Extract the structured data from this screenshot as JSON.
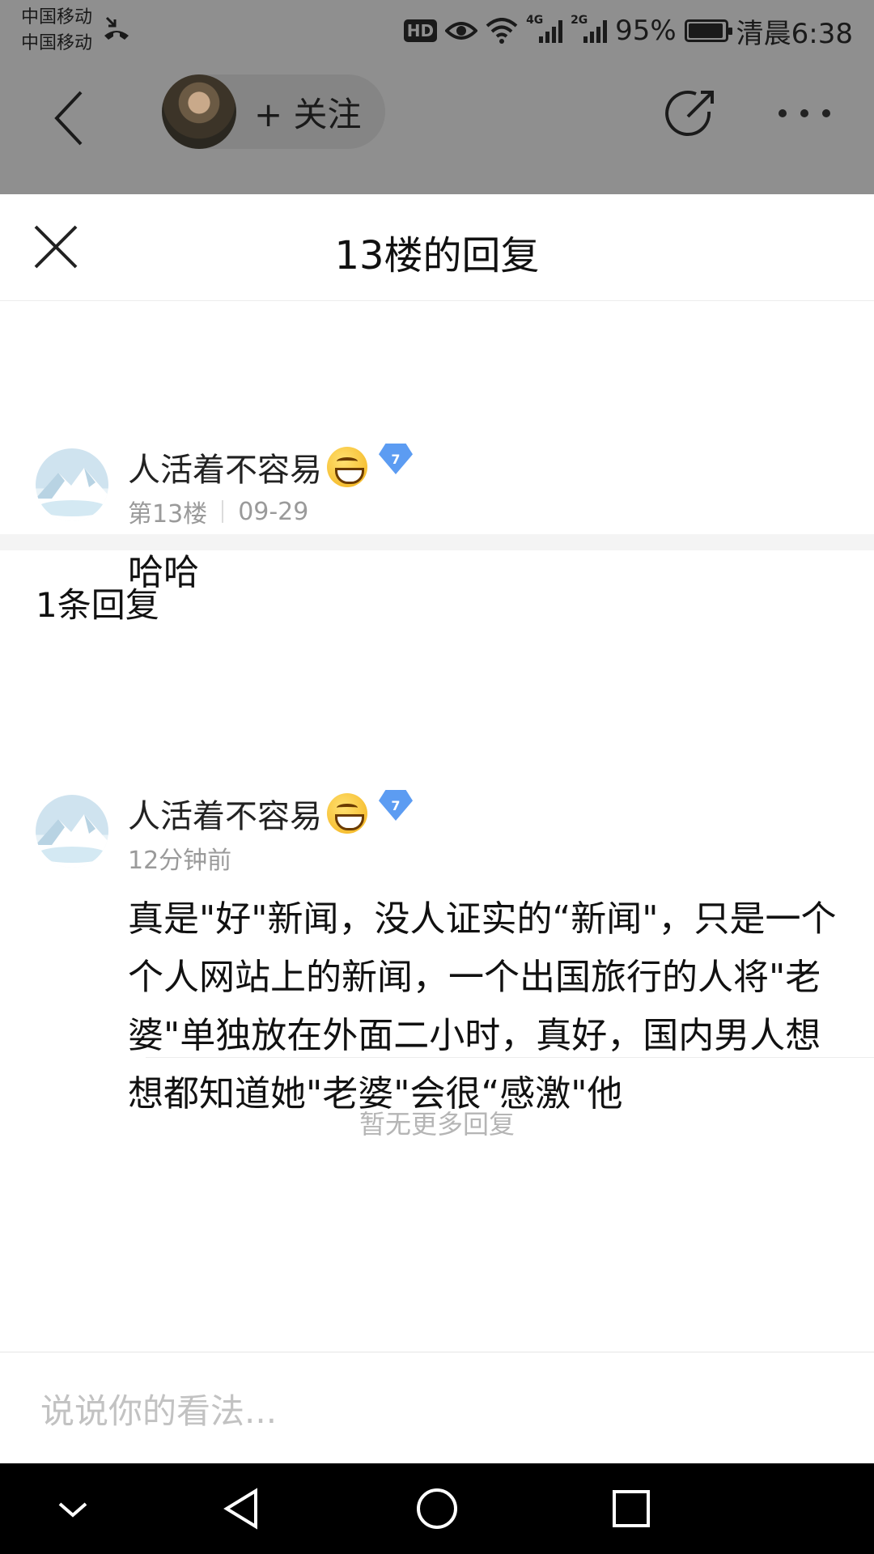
{
  "status_bar": {
    "carrier_1": "中国移动",
    "carrier_2": "中国移动",
    "hd": "HD",
    "net_1": "4G",
    "net_2": "2G",
    "battery": "95%",
    "time": "清晨6:38"
  },
  "nav": {
    "follow_label": "+ 关注"
  },
  "sheet": {
    "title": "13楼的回复"
  },
  "post": {
    "author": "人活着不容易",
    "level": "7",
    "floor": "第13楼",
    "date": "09-29",
    "text": "哈哈"
  },
  "replies": {
    "count_label": "1条回复",
    "items": [
      {
        "author": "人活着不容易",
        "level": "7",
        "time": "12分钟前",
        "text": "真是\"好\"新闻，没人证实的“新闻\"，只是一个个人网站上的新闻，一个出国旅行的人将\"老婆\"单独放在外面二小时，真好，国内男人想想都知道她\"老婆\"会很“感激\"他"
      }
    ],
    "no_more": "暂无更多回复"
  },
  "comment": {
    "placeholder": "说说你的看法..."
  },
  "icons": {
    "back": "chevron-left-icon",
    "share": "share-icon",
    "more": "more-icon",
    "close": "close-icon"
  }
}
